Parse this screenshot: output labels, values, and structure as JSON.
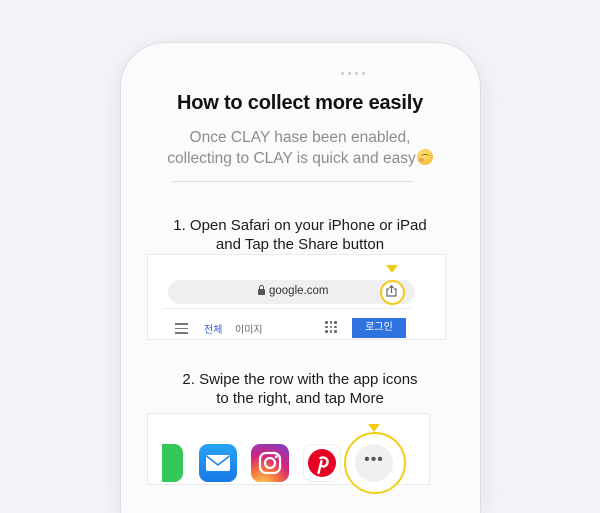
{
  "guide": {
    "title": "How to collect more easily",
    "subtitle_line1": "Once CLAY hase been enabled,",
    "subtitle_line2": "collecting to CLAY is quick and easy",
    "emoji_icon": "hugging-face-emoji"
  },
  "steps": [
    {
      "line1": "1. Open Safari on your iPhone or iPad",
      "line2": "and Tap the Share button"
    },
    {
      "line1": "2. Swipe the row with the app icons",
      "line2": "to the right, and tap More"
    }
  ],
  "safari_mock": {
    "url": "google.com",
    "lock_icon": "lock-icon",
    "share_icon": "share-icon",
    "tab_all": "전체",
    "tab_images": "이미지",
    "apps_icon": "apps-grid-icon",
    "login_label": "로그인"
  },
  "share_row": {
    "apps": [
      "messages-icon",
      "mail-icon",
      "instagram-icon",
      "pinterest-icon"
    ],
    "more_label": "•••"
  },
  "colors": {
    "highlight": "#f2cd18",
    "login_button": "#2f73e0",
    "background": "#f4f5f8"
  }
}
